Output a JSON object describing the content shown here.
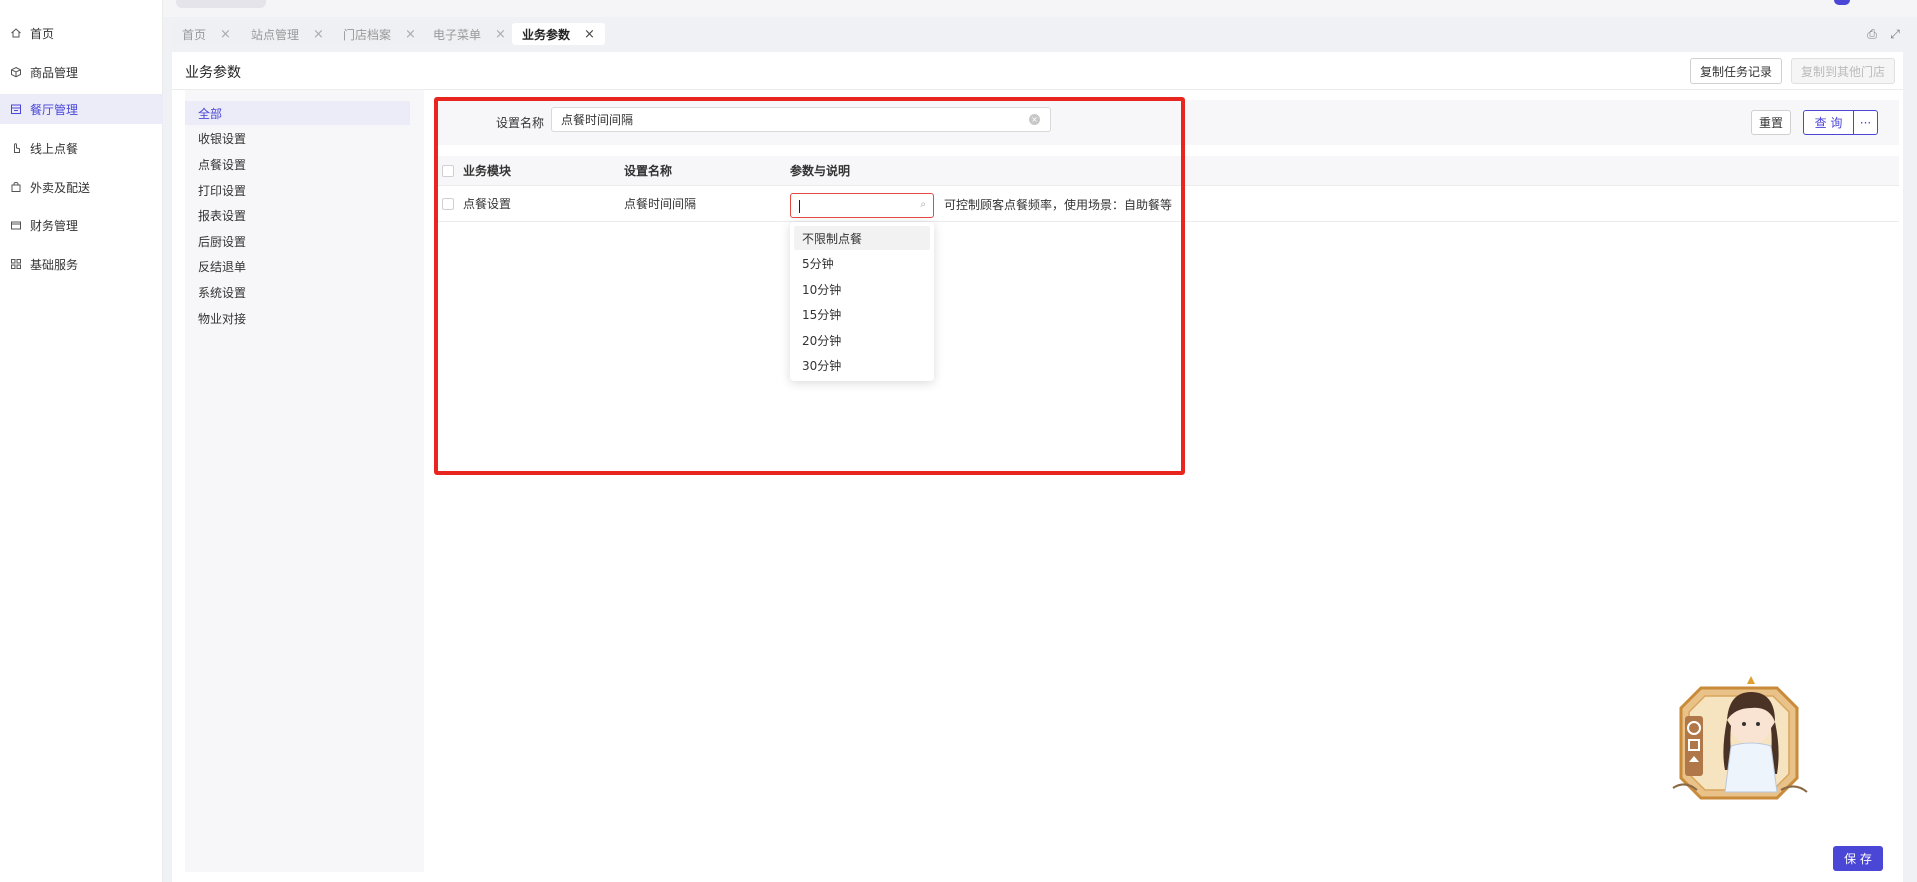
{
  "sidebar": {
    "items": [
      {
        "label": "首页",
        "icon": "home-icon"
      },
      {
        "label": "商品管理",
        "icon": "box-icon"
      },
      {
        "label": "餐厅管理",
        "icon": "store-icon",
        "active": true
      },
      {
        "label": "线上点餐",
        "icon": "hand-pointer-icon"
      },
      {
        "label": "外卖及配送",
        "icon": "bag-icon"
      },
      {
        "label": "财务管理",
        "icon": "wallet-icon"
      },
      {
        "label": "基础服务",
        "icon": "grid-icon"
      }
    ]
  },
  "tabs": [
    {
      "label": "首页",
      "close": "×"
    },
    {
      "label": "站点管理",
      "close": "×"
    },
    {
      "label": "门店档案",
      "close": "×"
    },
    {
      "label": "电子菜单",
      "close": "×"
    },
    {
      "label": "业务参数",
      "close": "×",
      "active": true
    }
  ],
  "tab_tools": {
    "print_icon": "⎙",
    "fullscreen_icon": "⤢"
  },
  "page": {
    "title": "业务参数",
    "copy_task_record": "复制任务记录",
    "copy_to_other_store": "复制到其他门店"
  },
  "categories": [
    "全部",
    "收银设置",
    "点餐设置",
    "打印设置",
    "报表设置",
    "后厨设置",
    "反结退单",
    "系统设置",
    "物业对接"
  ],
  "filter": {
    "label": "设置名称",
    "value": "点餐时间间隔",
    "clear_icon": "×",
    "reset": "重置",
    "query": "查 询",
    "more": "···"
  },
  "table": {
    "headers": [
      "业务模块",
      "设置名称",
      "参数与说明"
    ],
    "rows": [
      {
        "module": "点餐设置",
        "name": "点餐时间间隔",
        "description": "可控制顾客点餐频率，使用场景：自助餐等"
      }
    ]
  },
  "dropdown": {
    "search_icon": "⌕",
    "options": [
      "不限制点餐",
      "5分钟",
      "10分钟",
      "15分钟",
      "20分钟",
      "30分钟"
    ]
  },
  "save": "保 存",
  "colors": {
    "accent": "#4a46d6",
    "highlight": "#e8261f"
  }
}
